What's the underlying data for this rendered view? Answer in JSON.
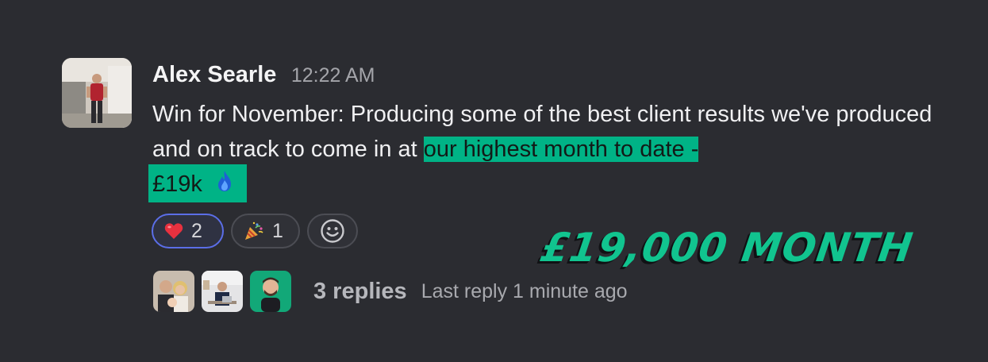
{
  "message": {
    "author": "Alex Searle",
    "time": "12:22 AM",
    "text_before": "Win for November: Producing some of the best client results we've produced and on track to come in at",
    "text_highlight_1": "our highest month to date -",
    "text_highlight_2": "£19k"
  },
  "reactions": [
    {
      "emoji": "heart",
      "count": "2"
    },
    {
      "emoji": "party-popper",
      "count": "1"
    }
  ],
  "thread": {
    "replies": "3 replies",
    "last_reply": "Last reply 1 minute ago"
  },
  "banner": "£19,000 MONTH",
  "colors": {
    "background": "#2b2c31",
    "highlight": "#00b386",
    "banner": "#11c48f",
    "active_reaction_border": "#5b6ee8"
  }
}
